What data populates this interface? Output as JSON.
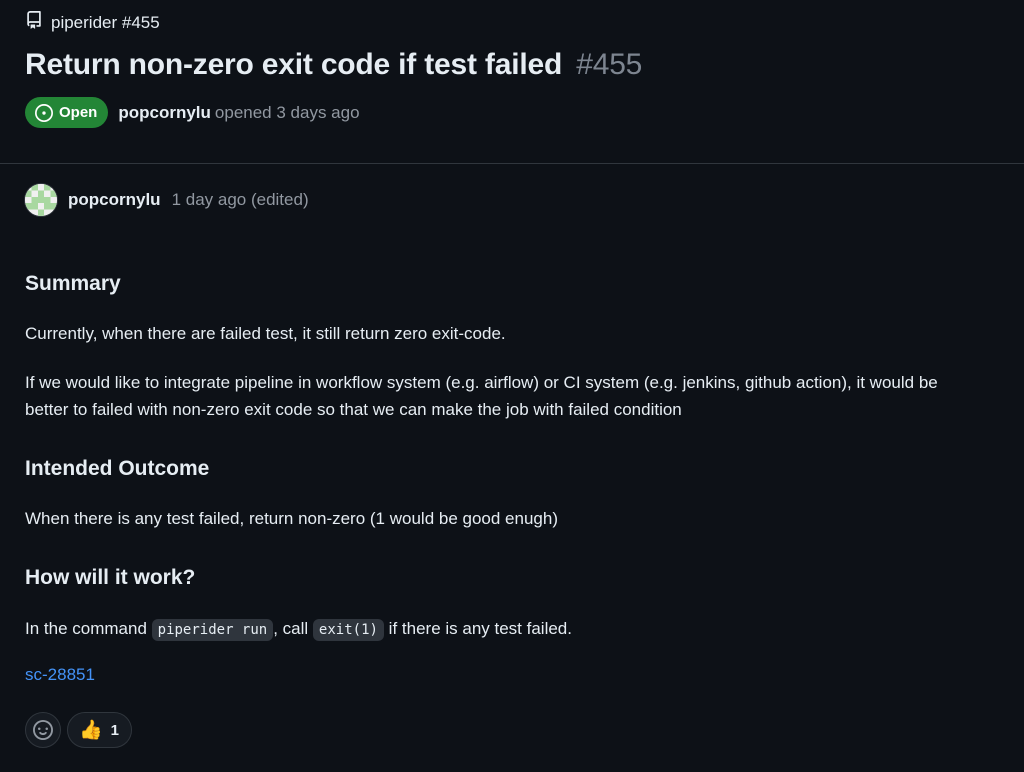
{
  "repo": {
    "label": "piperider #455",
    "icon": "repo-icon"
  },
  "issue": {
    "title": "Return non-zero exit code if test failed",
    "number": "#455",
    "state": "Open",
    "author": "popcornylu",
    "opened_text": "opened 3 days ago"
  },
  "comment": {
    "author": "popcornylu",
    "time": "1 day ago (edited)",
    "sections": {
      "summary_heading": "Summary",
      "summary_p1": "Currently, when there are failed test, it still return zero exit-code.",
      "summary_p2": "If we would like to integrate pipeline in workflow system (e.g. airflow) or CI system (e.g. jenkins, github action), it would be better to failed with non-zero exit code so that we can make the job with failed condition",
      "outcome_heading": "Intended Outcome",
      "outcome_p": "When there is any test failed, return non-zero (1 would be good enugh)",
      "how_heading": "How will it work?",
      "how_prefix": "In the command",
      "how_code1": "piperider run",
      "how_mid": ", call",
      "how_code2": "exit(1)",
      "how_suffix": "if there is any test failed."
    },
    "link": "sc-28851"
  },
  "reactions": {
    "add_icon": "smiley-icon",
    "thumbs_up_emoji": "👍",
    "thumbs_up_count": "1"
  },
  "colors": {
    "background": "#0d1117",
    "open_badge": "#238636",
    "link": "#4493f8",
    "muted_text": "#9198a1"
  }
}
